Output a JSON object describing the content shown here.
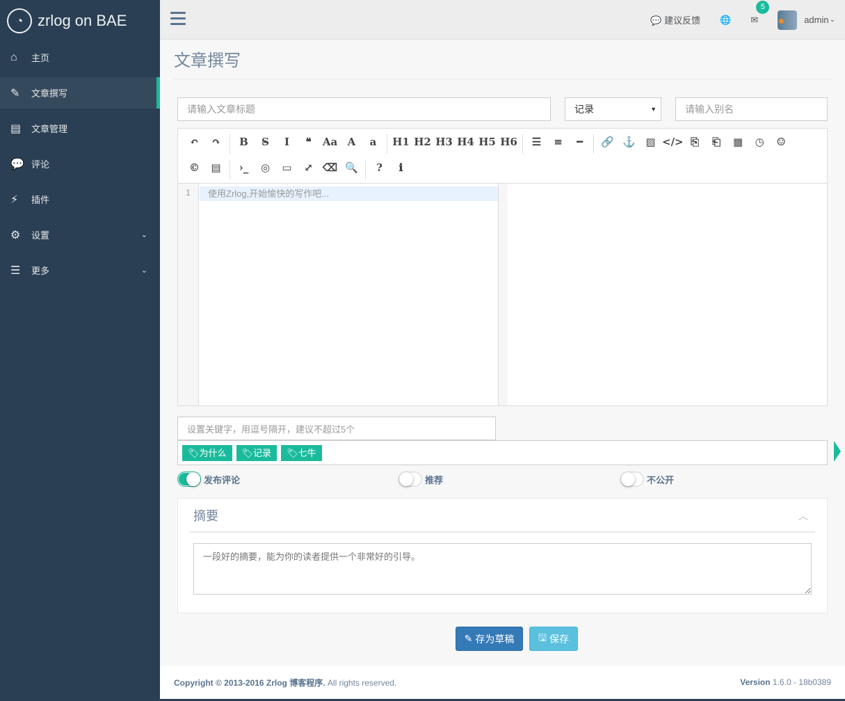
{
  "sidebar": {
    "brand": "zrlog on BAE",
    "items": [
      {
        "label": "主页",
        "icon": "home-icon",
        "glyph": "⌂"
      },
      {
        "label": "文章撰写",
        "icon": "edit-icon",
        "glyph": "✎",
        "active": true
      },
      {
        "label": "文章管理",
        "icon": "newspaper-icon",
        "glyph": "▤"
      },
      {
        "label": "评论",
        "icon": "comment-icon",
        "glyph": "💬"
      },
      {
        "label": "插件",
        "icon": "plug-icon",
        "glyph": "⚡"
      },
      {
        "label": "设置",
        "icon": "cogs-icon",
        "glyph": "⚙",
        "chevron": true
      },
      {
        "label": "更多",
        "icon": "list-icon",
        "glyph": "☰",
        "chevron": true
      }
    ]
  },
  "topbar": {
    "feedback": "建议反馈",
    "mail_count": "5",
    "user": "admin"
  },
  "page": {
    "title": "文章撰写"
  },
  "form": {
    "title_placeholder": "请输入文章标题",
    "category": "记录",
    "alias_placeholder": "请输入别名",
    "keywords_placeholder": "设置关键字，用逗号隔开，建议不超过5个",
    "tags": [
      "为什么",
      "记录",
      "七牛"
    ],
    "switches": [
      {
        "label": "发布评论",
        "on": true
      },
      {
        "label": "推荐",
        "on": false
      },
      {
        "label": "不公开",
        "on": false
      }
    ],
    "summary_title": "摘要",
    "summary_placeholder": "一段好的摘要，能为你的读者提供一个非常好的引导。"
  },
  "editor": {
    "line_number": "1",
    "placeholder": "使用Zrlog,开始愉快的写作吧...",
    "toolbar": [
      [
        "↶",
        "undo"
      ],
      [
        "↷",
        "redo"
      ],
      "|",
      [
        "B",
        "bold"
      ],
      [
        "S̶",
        "strikethrough"
      ],
      [
        "I",
        "italic"
      ],
      [
        "❝",
        "quote"
      ],
      [
        "Aa",
        "uppercase"
      ],
      [
        "A",
        "uppercase-first"
      ],
      [
        "a",
        "lowercase"
      ],
      "|",
      [
        "H1",
        "h1"
      ],
      [
        "H2",
        "h2"
      ],
      [
        "H3",
        "h3"
      ],
      [
        "H4",
        "h4"
      ],
      [
        "H5",
        "h5"
      ],
      [
        "H6",
        "h6"
      ],
      "|",
      [
        "☰",
        "list-ul"
      ],
      [
        "≡",
        "list-ol"
      ],
      [
        "━",
        "hr"
      ],
      "|",
      [
        "🔗",
        "link"
      ],
      [
        "⚓",
        "anchor"
      ],
      [
        "▨",
        "image"
      ],
      [
        "</>",
        "code"
      ],
      [
        "⎘",
        "preformatted-code"
      ],
      [
        "⎗",
        "code-block"
      ],
      [
        "▦",
        "table"
      ],
      [
        "◷",
        "datetime"
      ],
      [
        "☺",
        "emoji"
      ],
      [
        "©",
        "html-entities"
      ],
      [
        "▤",
        "pagebreak"
      ],
      "|",
      [
        "›_",
        "goto-line"
      ],
      [
        "◎",
        "watch"
      ],
      [
        "▭",
        "preview"
      ],
      [
        "⤢",
        "fullscreen"
      ],
      [
        "⌫",
        "clear"
      ],
      [
        "🔍",
        "search"
      ],
      "|",
      [
        "?",
        "help"
      ],
      [
        "ℹ",
        "info"
      ]
    ]
  },
  "actions": {
    "draft": "存为草稿",
    "save": "保存"
  },
  "footer": {
    "copyright_bold": "Copyright © 2013-2016 Zrlog 博客程序.",
    "copyright_rest": " All rights reserved.",
    "version_label": "Version",
    "version": " 1.6.0 - 18b0389"
  }
}
